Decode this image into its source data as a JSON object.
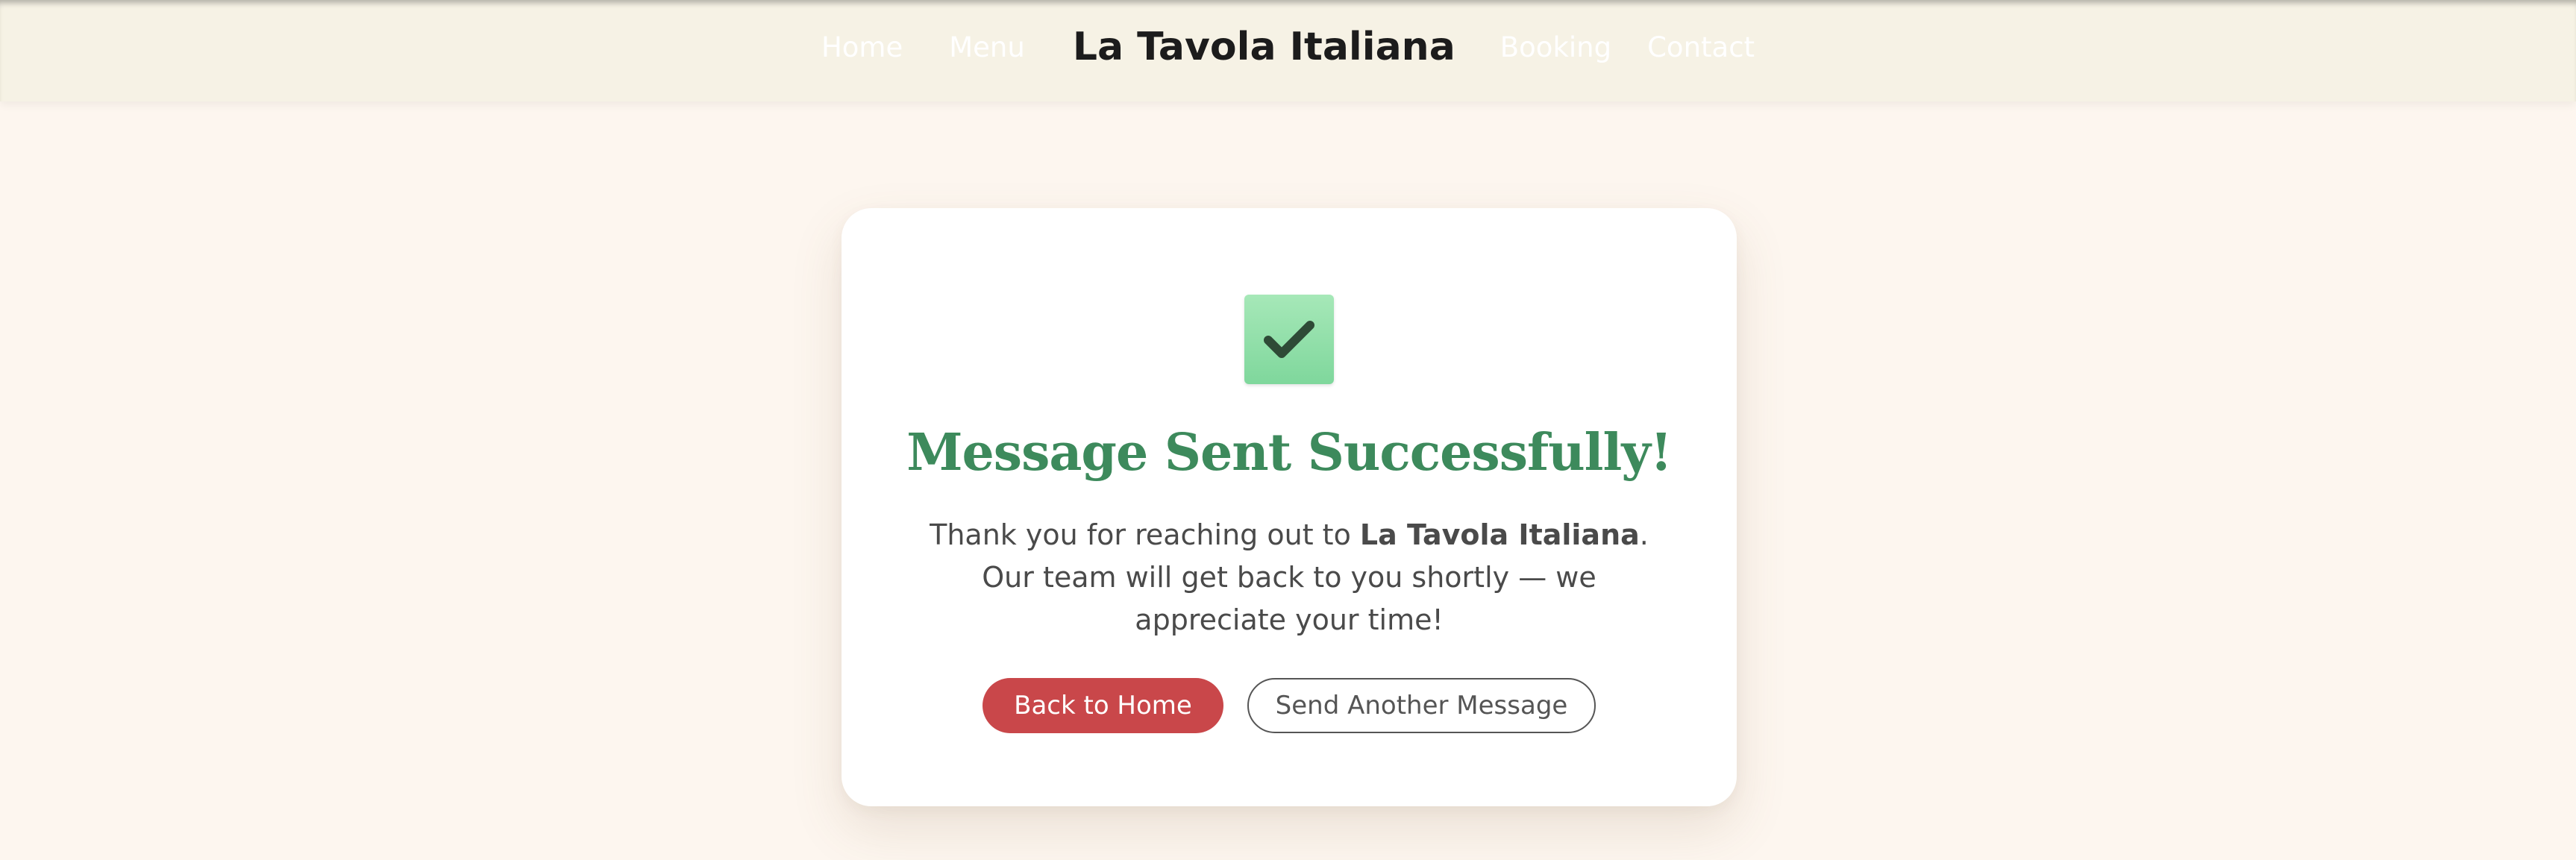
{
  "nav": {
    "brand": "La Tavola Italiana",
    "links": [
      {
        "label": "Home"
      },
      {
        "label": "Menu"
      },
      {
        "label": "Booking"
      },
      {
        "label": "Contact"
      }
    ]
  },
  "confirmation": {
    "icon": "check-mark-icon",
    "title": "Message Sent Successfully!",
    "message_before": "Thank you for reaching out to ",
    "message_brand": "La Tavola Italiana",
    "message_after": ". Our team will get back to you shortly — we appreciate your time!",
    "primary_button": "Back to Home",
    "secondary_button": "Send Another Message"
  },
  "colors": {
    "page_background": "#fdf6ef",
    "navbar_background": "#f6f2e5",
    "title_green": "#3d8a5c",
    "primary_red": "#c9474a",
    "icon_green": "#7fd79c"
  }
}
